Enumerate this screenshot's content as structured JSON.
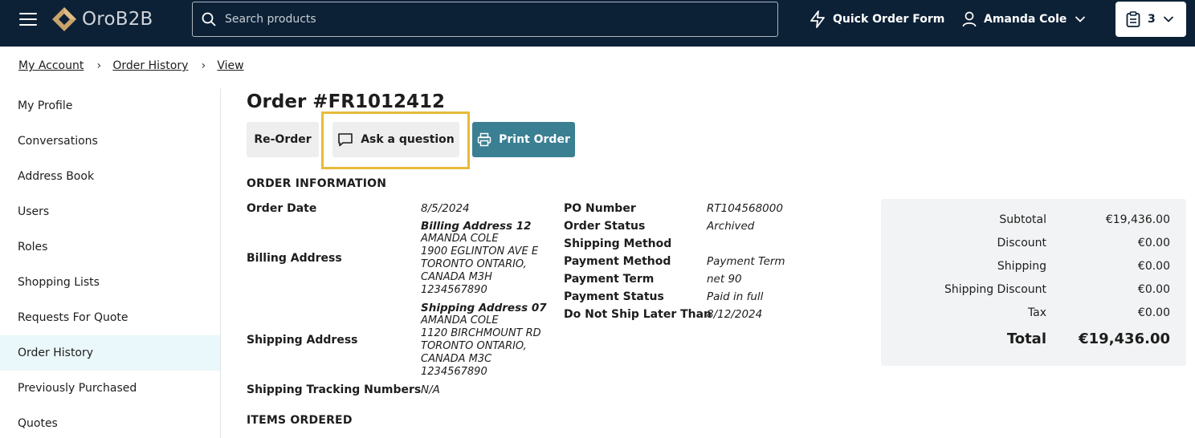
{
  "header": {
    "logo_text": "OroB2B",
    "search_placeholder": "Search products",
    "quick_order_label": "Quick Order Form",
    "user_name": "Amanda Cole",
    "cart_count": "3"
  },
  "breadcrumb": {
    "items": [
      "My Account",
      "Order History",
      "View"
    ],
    "separator": "›"
  },
  "sidebar": {
    "items": [
      {
        "label": "My Profile"
      },
      {
        "label": "Conversations"
      },
      {
        "label": "Address Book"
      },
      {
        "label": "Users"
      },
      {
        "label": "Roles"
      },
      {
        "label": "Shopping Lists"
      },
      {
        "label": "Requests For Quote"
      },
      {
        "label": "Order History"
      },
      {
        "label": "Previously Purchased"
      },
      {
        "label": "Quotes"
      }
    ],
    "active_item": "Order History"
  },
  "order": {
    "title": "Order #FR1012412",
    "buttons": {
      "reorder": "Re-Order",
      "ask": "Ask a question",
      "print": "Print Order"
    },
    "info_heading": "ORDER INFORMATION",
    "items_heading": "ITEMS ORDERED",
    "order_date_label": "Order Date",
    "order_date": "8/5/2024",
    "billing_label": "Billing Address",
    "billing": {
      "name": "Billing Address 12",
      "lines": [
        "AMANDA COLE",
        "1900 EGLINTON AVE E",
        "TORONTO ONTARIO,",
        "CANADA M3H",
        "1234567890"
      ]
    },
    "shipping_label": "Shipping Address",
    "shipping": {
      "name": "Shipping Address 07",
      "lines": [
        "AMANDA COLE",
        "1120 BIRCHMOUNT RD",
        "TORONTO ONTARIO,",
        "CANADA M3C",
        "1234567890"
      ]
    },
    "tracking_label": "Shipping Tracking Numbers",
    "tracking": "N/A",
    "details": [
      {
        "label": "PO Number",
        "value": "RT104568000"
      },
      {
        "label": "Order Status",
        "value": "Archived"
      },
      {
        "label": "Shipping Method",
        "value": ""
      },
      {
        "label": "Payment Method",
        "value": "Payment Term"
      },
      {
        "label": "Payment Term",
        "value": "net 90"
      },
      {
        "label": "Payment Status",
        "value": "Paid in full"
      },
      {
        "label": "Do Not Ship Later Than",
        "value": "8/12/2024"
      }
    ]
  },
  "totals": {
    "rows": [
      {
        "label": "Subtotal",
        "value": "€19,436.00"
      },
      {
        "label": "Discount",
        "value": "€0.00"
      },
      {
        "label": "Shipping",
        "value": "€0.00"
      },
      {
        "label": "Shipping Discount",
        "value": "€0.00"
      },
      {
        "label": "Tax",
        "value": "€0.00"
      }
    ],
    "total_label": "Total",
    "total_value": "€19,436.00"
  },
  "colors": {
    "header_bg": "#0c2136",
    "accent": "#3a7f92",
    "highlight": "#e7bb3b",
    "logo_mark": "#c9a36b"
  },
  "icons": [
    "menu-icon",
    "logo-icon",
    "search-icon",
    "lightning-icon",
    "user-icon",
    "chevron-down-icon",
    "clipboard-icon",
    "chat-bubble-icon",
    "printer-icon"
  ]
}
